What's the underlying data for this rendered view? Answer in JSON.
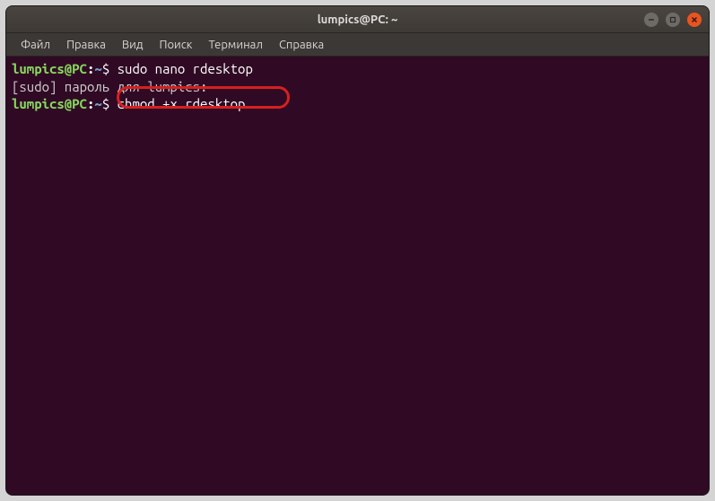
{
  "window": {
    "title": "lumpics@PC: ~"
  },
  "menubar": {
    "items": [
      {
        "label": "Файл"
      },
      {
        "label": "Правка"
      },
      {
        "label": "Вид"
      },
      {
        "label": "Поиск"
      },
      {
        "label": "Терминал"
      },
      {
        "label": "Справка"
      }
    ]
  },
  "terminal": {
    "lines": [
      {
        "user": "lumpics@PC",
        "colon": ":",
        "path": "~",
        "dollar": "$ ",
        "command": "sudo nano rdesktop"
      },
      {
        "raw": "[sudo] пароль для lumpics:"
      },
      {
        "user": "lumpics@PC",
        "colon": ":",
        "path": "~",
        "dollar": "$ ",
        "command": "chmod +x rdesktop"
      }
    ]
  },
  "highlight": {
    "target_line_index": 2
  },
  "colors": {
    "terminal_bg": "#300a24",
    "prompt_user": "#87d75f",
    "prompt_path": "#6f9fcf",
    "text": "#ffffff",
    "highlight_border": "#d62020"
  }
}
